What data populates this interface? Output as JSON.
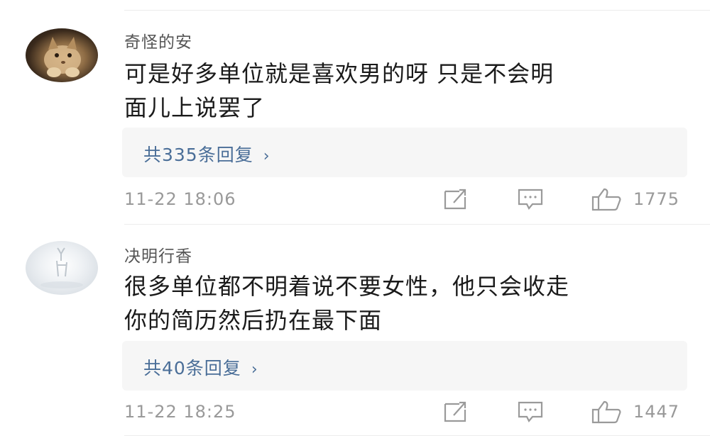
{
  "comments": [
    {
      "username": "奇怪的安",
      "avatar_icon": "cat-avatar",
      "text_line1": "可是好多单位就是喜欢男的呀 只是不会明",
      "text_line2": "面儿上说罢了",
      "reply_label": "共335条回复",
      "reply_chevron": "›",
      "timestamp": "11-22 18:06",
      "like_count": "1775"
    },
    {
      "username": "决明行香",
      "avatar_icon": "deer-avatar",
      "text_line1": "很多单位都不明着说不要女性，他只会收走",
      "text_line2": "你的简历然后扔在最下面",
      "reply_label": "共40条回复",
      "reply_chevron": "›",
      "timestamp": "11-22 18:25",
      "like_count": "1447"
    }
  ],
  "colors": {
    "link": "#4a6e98",
    "meta": "#999999",
    "text": "#1a1a1a"
  }
}
